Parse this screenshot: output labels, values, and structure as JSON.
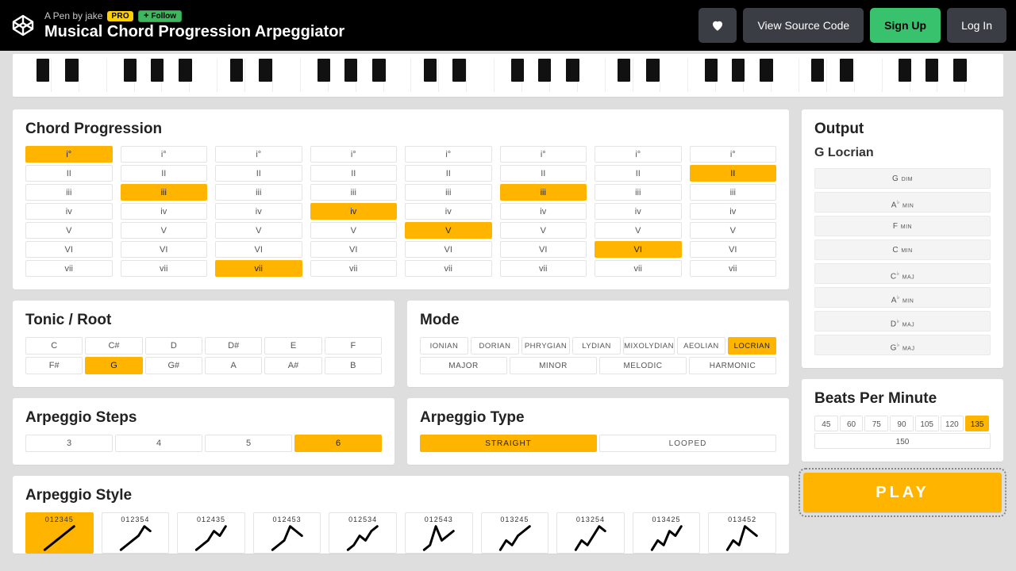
{
  "header": {
    "byline": "A Pen by jake",
    "pro_badge": "PRO",
    "follow_label": "Follow",
    "pen_title": "Musical Chord Progression Arpeggiator",
    "view_source": "View Source Code",
    "sign_up": "Sign Up",
    "log_in": "Log In"
  },
  "piano": {
    "white_count": 35,
    "octave_black_offsets_pct": [
      1.3,
      4.3,
      10.3,
      13.1,
      16.0
    ]
  },
  "progression": {
    "title": "Chord Progression",
    "degree_labels": [
      "i°",
      "II",
      "iii",
      "iv",
      "V",
      "VI",
      "vii"
    ],
    "num_columns": 8,
    "selected": [
      0,
      2,
      6,
      3,
      4,
      2,
      5,
      1
    ]
  },
  "tonic": {
    "title": "Tonic / Root",
    "notes": [
      "C",
      "C#",
      "D",
      "D#",
      "E",
      "F",
      "F#",
      "G",
      "G#",
      "A",
      "A#",
      "B"
    ],
    "selected": "G"
  },
  "mode": {
    "title": "Mode",
    "modes": [
      "IONIAN",
      "DORIAN",
      "PHRYGIAN",
      "LYDIAN",
      "MIXOLYDIAN",
      "AEOLIAN",
      "LOCRIAN"
    ],
    "families": [
      "MAJOR",
      "MINOR",
      "MELODIC",
      "HARMONIC"
    ],
    "selected": "LOCRIAN"
  },
  "steps": {
    "title": "Arpeggio Steps",
    "values": [
      "3",
      "4",
      "5",
      "6"
    ],
    "selected": "6"
  },
  "arp_type": {
    "title": "Arpeggio Type",
    "values": [
      "STRAIGHT",
      "LOOPED"
    ],
    "selected": "STRAIGHT"
  },
  "arp_style": {
    "title": "Arpeggio Style",
    "labels": [
      "012345",
      "012354",
      "012435",
      "012453",
      "012534",
      "012543",
      "013245",
      "013254",
      "013425",
      "013452"
    ],
    "selected": 0
  },
  "output": {
    "title": "Output",
    "key_label": "G Locrian",
    "chords_plain": [
      "G dim",
      "Ab min",
      "F min",
      "C min",
      "Cb maj",
      "Ab min",
      "Db maj",
      "Gb maj"
    ],
    "chords_html": [
      "G <span class='sc'>dim</span>",
      "A<sup>♭</sup> <span class='sc'>min</span>",
      "F <span class='sc'>min</span>",
      "C <span class='sc'>min</span>",
      "C<sup>♭</sup> <span class='sc'>maj</span>",
      "A<sup>♭</sup> <span class='sc'>min</span>",
      "D<sup>♭</sup> <span class='sc'>maj</span>",
      "G<sup>♭</sup> <span class='sc'>maj</span>"
    ]
  },
  "bpm": {
    "title": "Beats Per Minute",
    "values": [
      "45",
      "60",
      "75",
      "90",
      "105",
      "120",
      "135",
      "150"
    ],
    "selected": "135"
  },
  "play_label": "PLAY",
  "colors": {
    "accent": "#ffb400",
    "signup": "#39c26d",
    "bg": "#dedede"
  }
}
